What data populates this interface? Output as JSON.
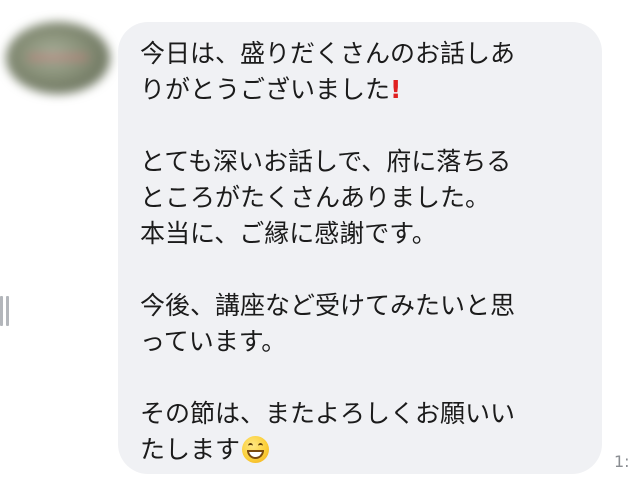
{
  "message": {
    "lines": [
      "今日は、盛りだくさんのお話しあ",
      "りがとうございました",
      "",
      "とても深いお話しで、府に落ちる",
      "ところがたくさんありました。",
      "本当に、ご縁に感謝です。",
      "",
      "今後、講座など受けてみたいと思",
      "っています。",
      "",
      "その節は、またよろしくお願いい",
      "たします"
    ],
    "exclamation_mark": "!",
    "emoji": "grinning-face-with-smiling-eyes",
    "timestamp": "1:"
  },
  "colors": {
    "bubble": "#f0f1f4",
    "text": "#1b1b1b",
    "exclamation": "#e02020",
    "timestamp": "#8a8d92"
  }
}
